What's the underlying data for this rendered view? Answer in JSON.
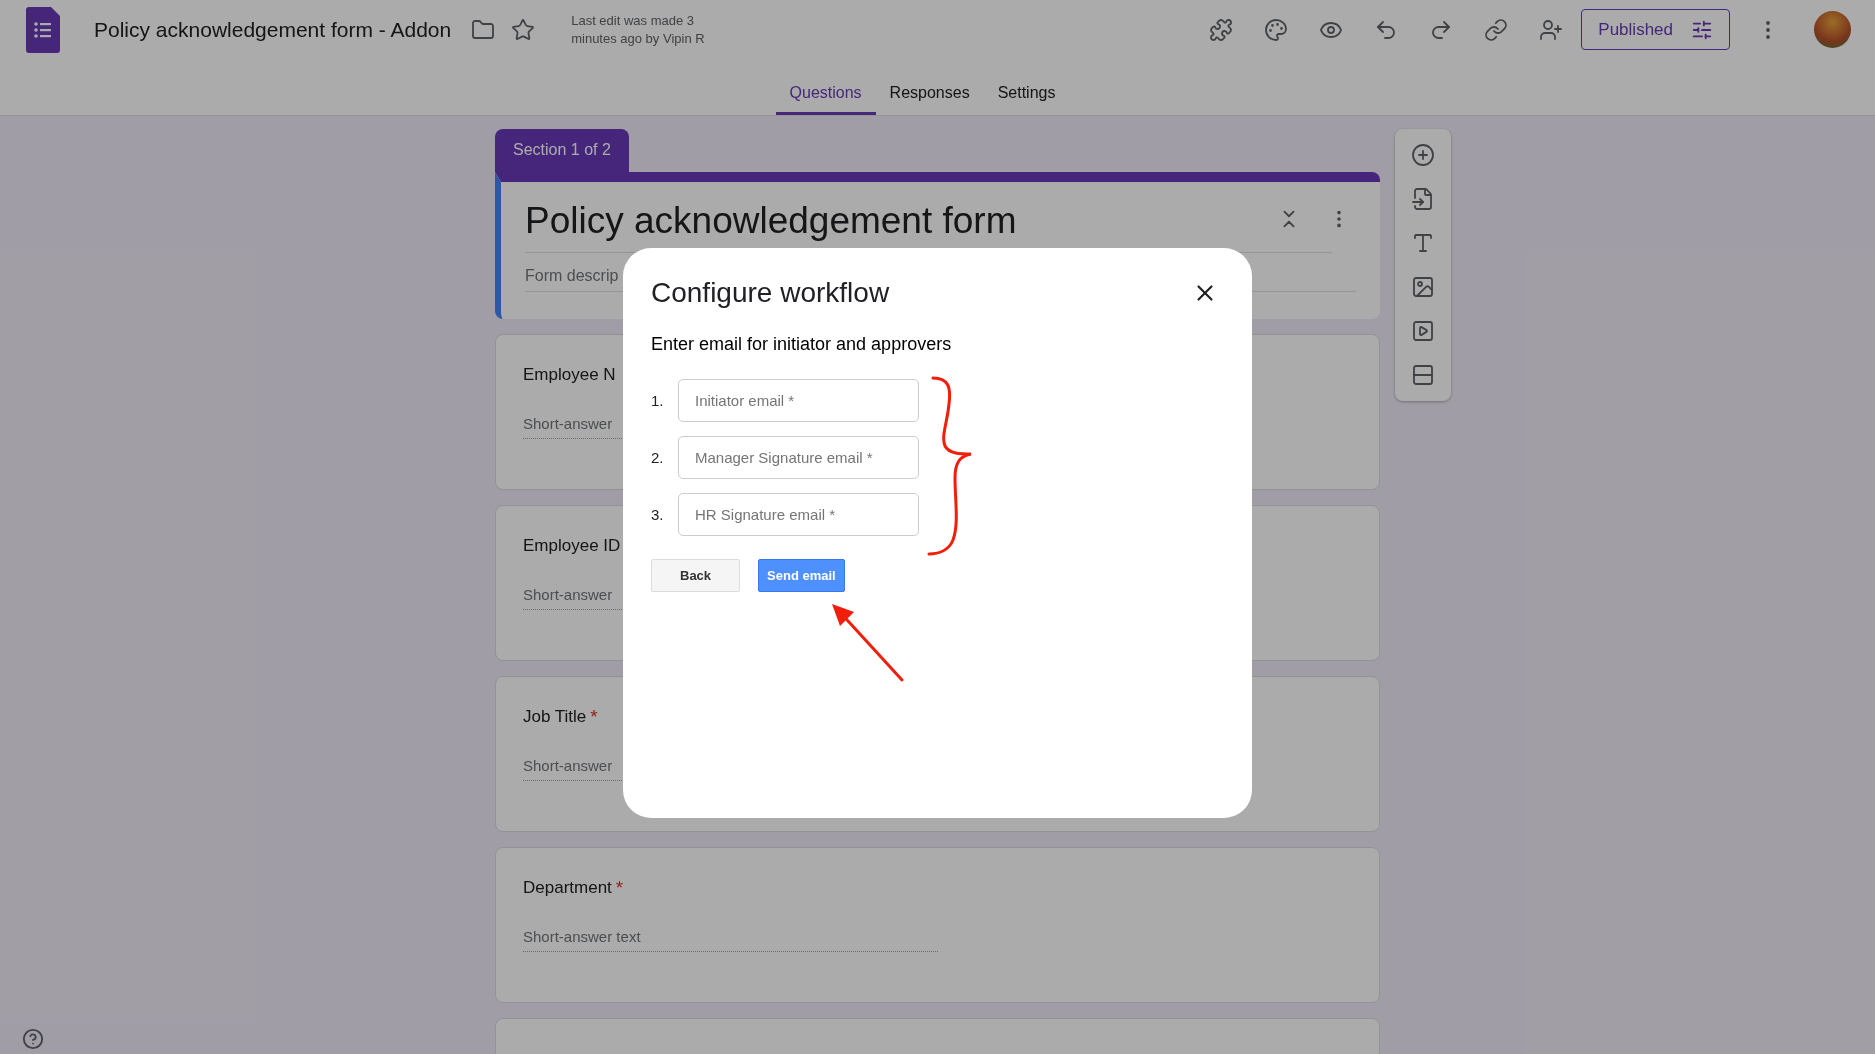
{
  "app": {
    "title": "Policy acknowledgement form - Addon",
    "last_edit": "Last edit was made 3 minutes ago by Vipin R",
    "publish_button": "Published"
  },
  "tabs": [
    {
      "label": "Questions",
      "selected": true
    },
    {
      "label": "Responses",
      "selected": false
    },
    {
      "label": "Settings",
      "selected": false
    }
  ],
  "section_tab": "Section 1 of 2",
  "form": {
    "title": "Policy acknowledgement form",
    "description": "Form descrip"
  },
  "questions": [
    {
      "title": "Employee N",
      "placeholder": "Short-answer"
    },
    {
      "title": "Employee ID",
      "placeholder": "Short-answer"
    },
    {
      "title": "Job Title",
      "required_mark": "*",
      "placeholder": "Short-answer"
    },
    {
      "title": "Department",
      "required_mark": "*",
      "placeholder": "Short-answer text"
    }
  ],
  "dialog": {
    "title": "Configure workflow",
    "subtitle": "Enter email for initiator and approvers",
    "fields": [
      {
        "number": "1.",
        "placeholder": "Initiator email *"
      },
      {
        "number": "2.",
        "placeholder": "Manager Signature email *"
      },
      {
        "number": "3.",
        "placeholder": "HR Signature email *"
      }
    ],
    "buttons": [
      {
        "label": "Back",
        "kind": "secondary"
      },
      {
        "label": "Send email",
        "kind": "primary"
      }
    ]
  }
}
